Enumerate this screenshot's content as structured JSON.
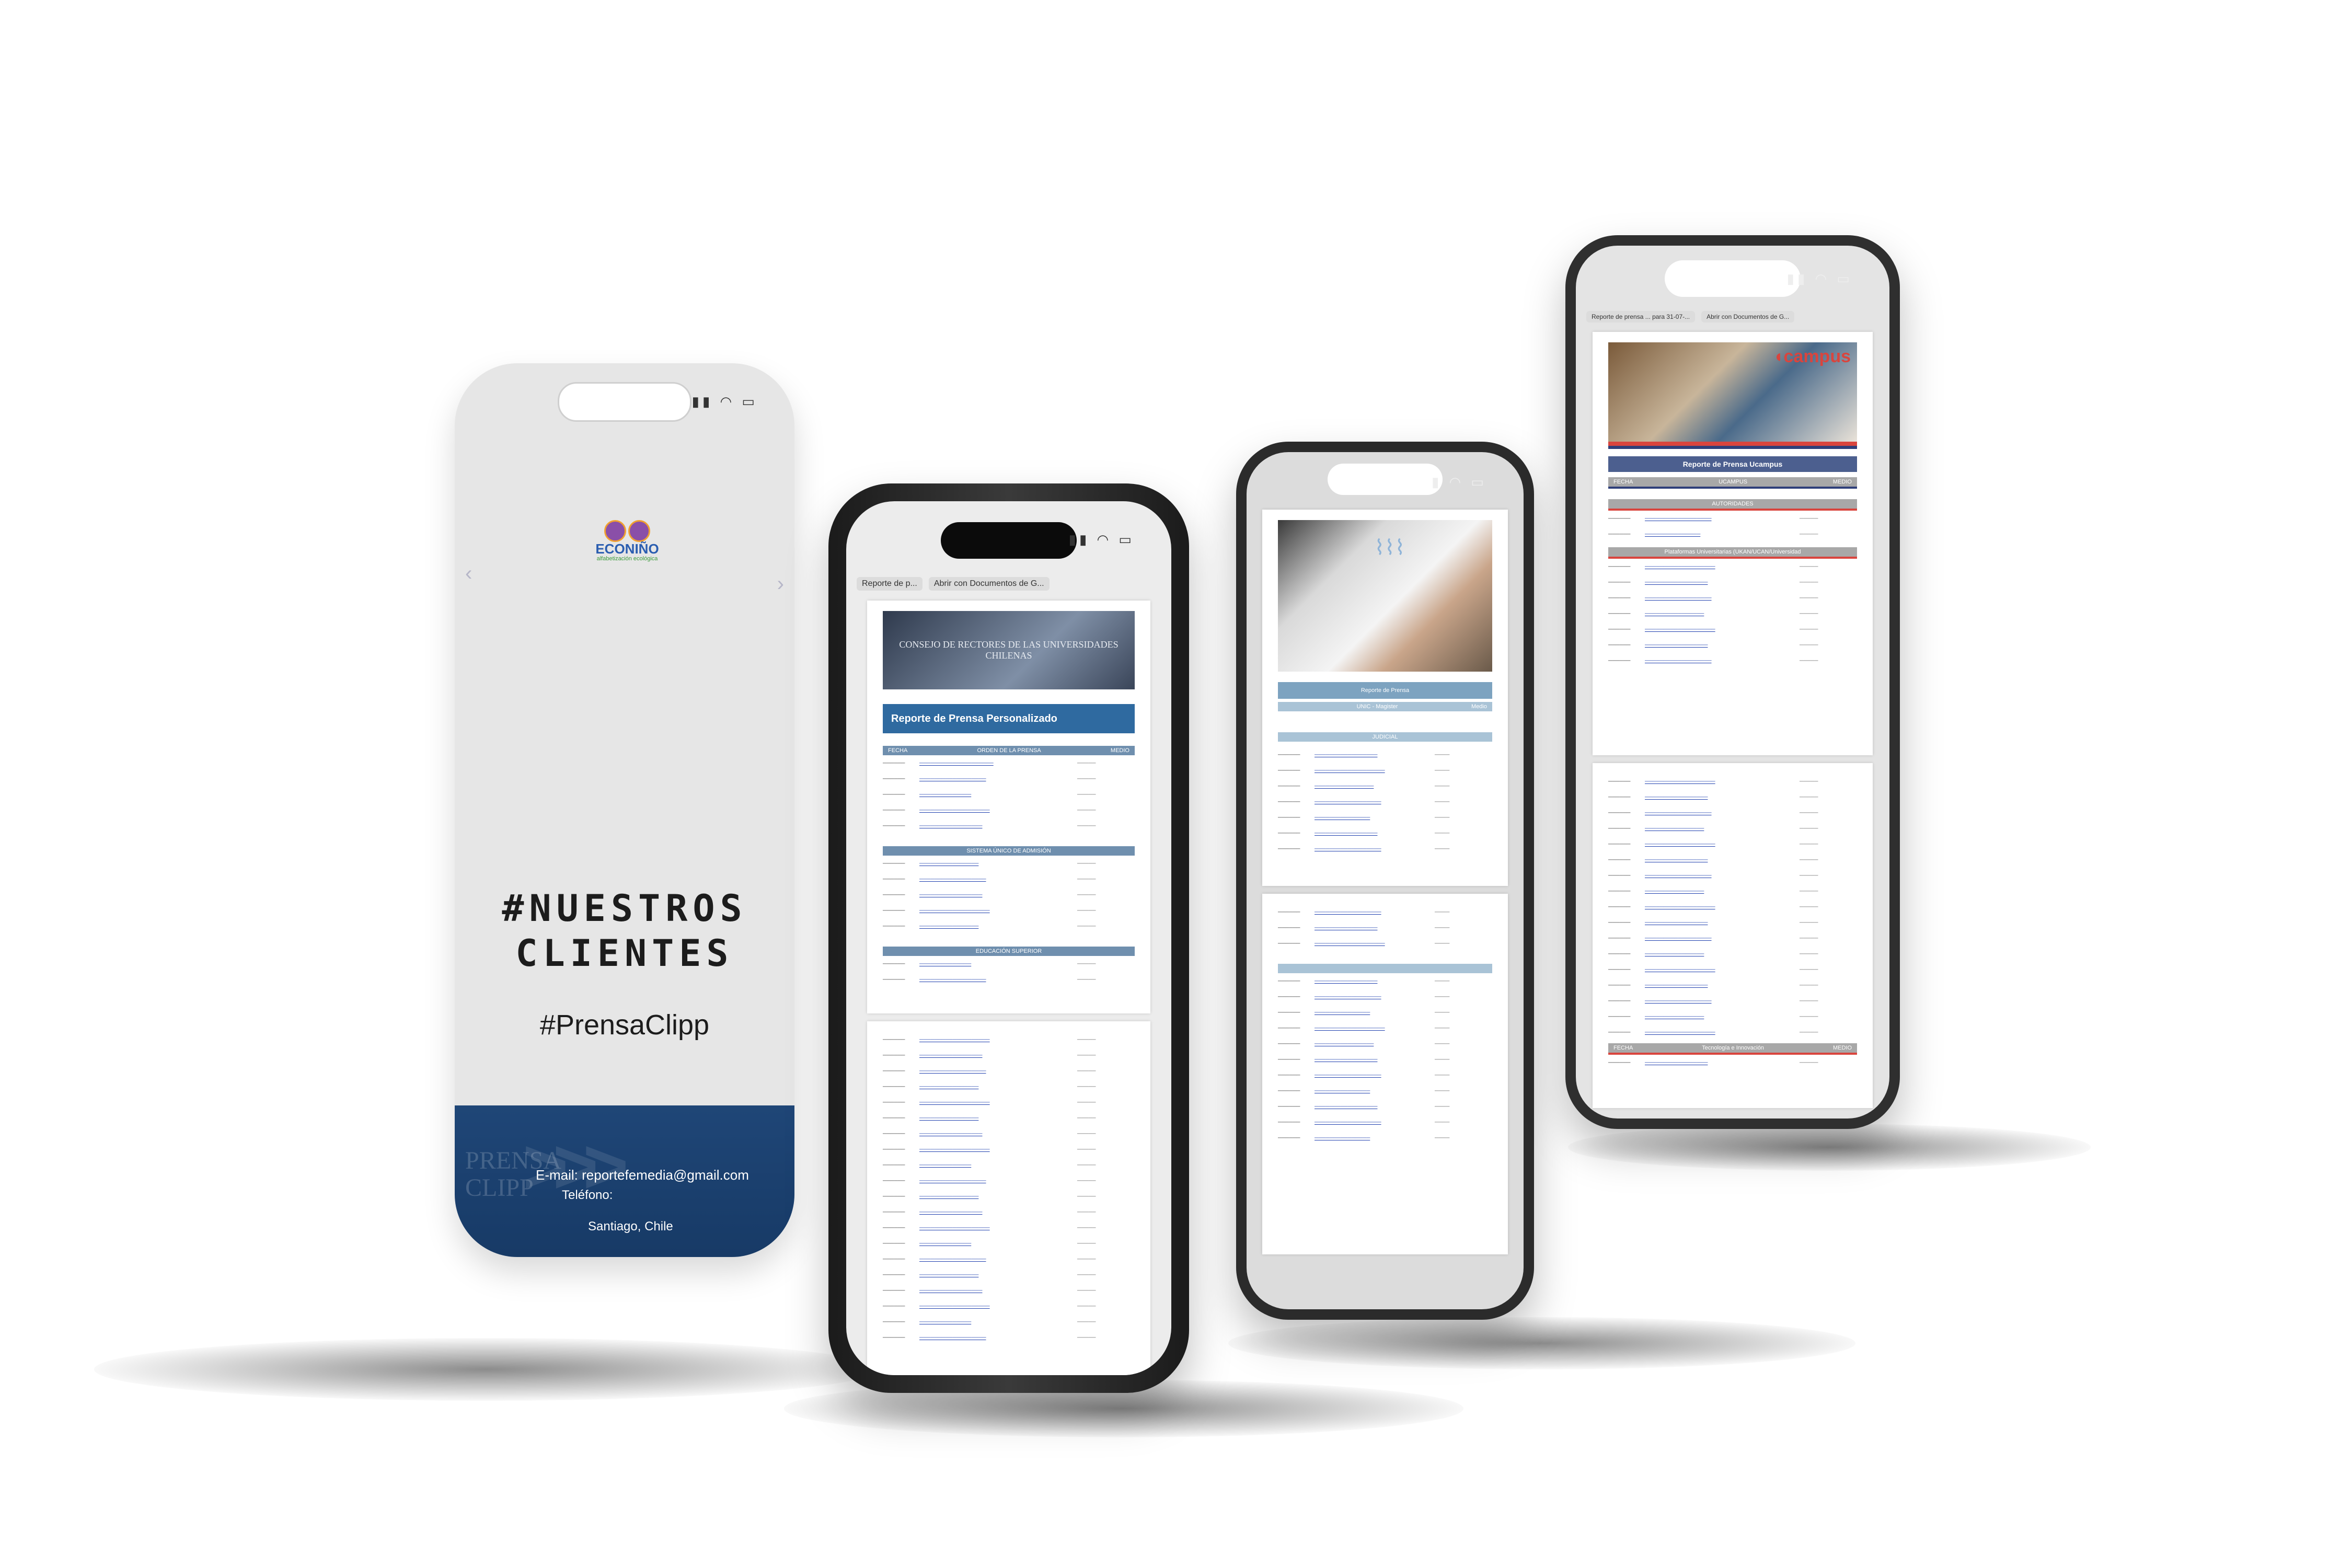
{
  "card": {
    "logo_word": "ECONIÑO",
    "logo_tagline": "alfabetización ecológica",
    "headline_line1": "#NUESTROS",
    "headline_line2": "CLIENTES",
    "hashtag": "#PrensaClipp",
    "watermark_top": "PRENSA",
    "watermark_bottom": "CLIPP",
    "email": "E-mail: reportefemedia@gmail.com",
    "phone_label": "Teléfono:",
    "location": "Santiago, Chile"
  },
  "phone2": {
    "tab1": "Reporte de p...",
    "tab2": "Abrir con Documentos de G...",
    "banner_text": "CONSEJO DE RECTORES DE LAS UNIVERSIDADES CHILENAS",
    "report_title": "Reporte de Prensa Personalizado",
    "section1": "ORDEN DE LA PRENSA",
    "section2": "SISTEMA ÚNICO DE ADMISIÓN",
    "section3": "EDUCACIÓN SUPERIOR",
    "col_date": "FECHA",
    "col_media": "MEDIO"
  },
  "phone3": {
    "report_title": "Reporte de Prensa",
    "section1": "UNIC - Magister",
    "section2": "JUDICIAL",
    "col_media": "Medio"
  },
  "phone4": {
    "tab1": "Reporte de prensa ... para 31-07-...",
    "tab2": "Abrir con Documentos de G...",
    "brand": "campus",
    "report_title": "Reporte de Prensa Ucampus",
    "section1": "UCAMPUS",
    "section2": "AUTORIDADES",
    "section3": "Plataformas Universitarias (UKAN/UCAN/Universidad",
    "section4": "Tecnología e Innovación",
    "col_date": "FECHA",
    "col_media": "MEDIO"
  },
  "colors": {
    "card_blue": "#1f4677",
    "report_blue": "#2f6aa0",
    "link_blue": "#1f3fae",
    "ucampus_red": "#d9453e"
  },
  "icons": [
    "signal-icon",
    "wifi-icon",
    "battery-icon",
    "chevron-left-icon",
    "chevron-right-icon"
  ]
}
